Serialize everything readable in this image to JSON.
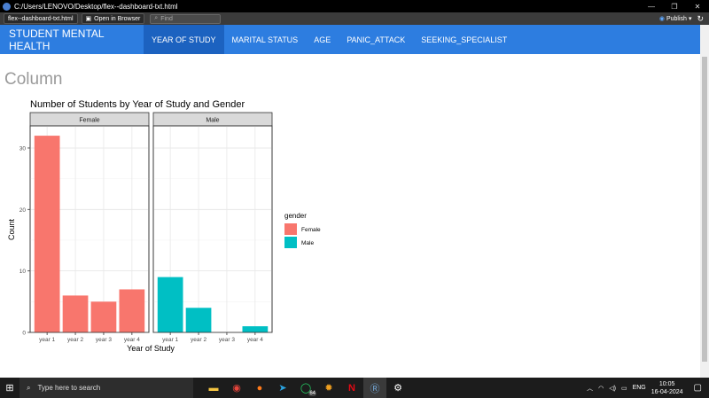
{
  "window": {
    "title": "C:/Users/LENOVO/Desktop/flex--dashboard-txt.html",
    "minimize_glyph": "—",
    "restore_glyph": "❐",
    "close_glyph": "✕"
  },
  "toolbar": {
    "tab_label": "flex--dashboard-txt.html",
    "open_browser_label": "Open in Browser",
    "find_placeholder": "Find",
    "publish_label": "Publish",
    "refresh_glyph": "↻"
  },
  "navbar": {
    "brand": "STUDENT MENTAL HEALTH",
    "items": [
      "YEAR OF STUDY",
      "MARITAL STATUS",
      "AGE",
      "PANIC_ATTACK",
      "SEEKING_SPECIALIST"
    ],
    "active_index": 0,
    "color": "#2d7de0",
    "active_color": "#1c62c0"
  },
  "page": {
    "heading": "Column"
  },
  "chart_data": {
    "type": "bar",
    "title": "Number of Students by Year of Study and Gender",
    "xlabel": "Year of Study",
    "ylabel": "Count",
    "categories": [
      "year 1",
      "year 2",
      "year 3",
      "year 4"
    ],
    "facets": [
      "Female",
      "Male"
    ],
    "series": [
      {
        "name": "Female",
        "color": "#f8766d",
        "values": [
          32,
          6,
          5,
          7
        ]
      },
      {
        "name": "Male",
        "color": "#00bfc4",
        "values": [
          9,
          4,
          0,
          1
        ]
      }
    ],
    "ylim": [
      0,
      33.6
    ],
    "yticks": [
      0,
      10,
      20,
      30
    ],
    "legend_title": "gender",
    "legend_position": "right",
    "grid": true
  },
  "taskbar": {
    "search_placeholder": "Type here to search",
    "badge": "64",
    "lang": "ENG",
    "time": "10:05",
    "date": "16-04-2024"
  }
}
